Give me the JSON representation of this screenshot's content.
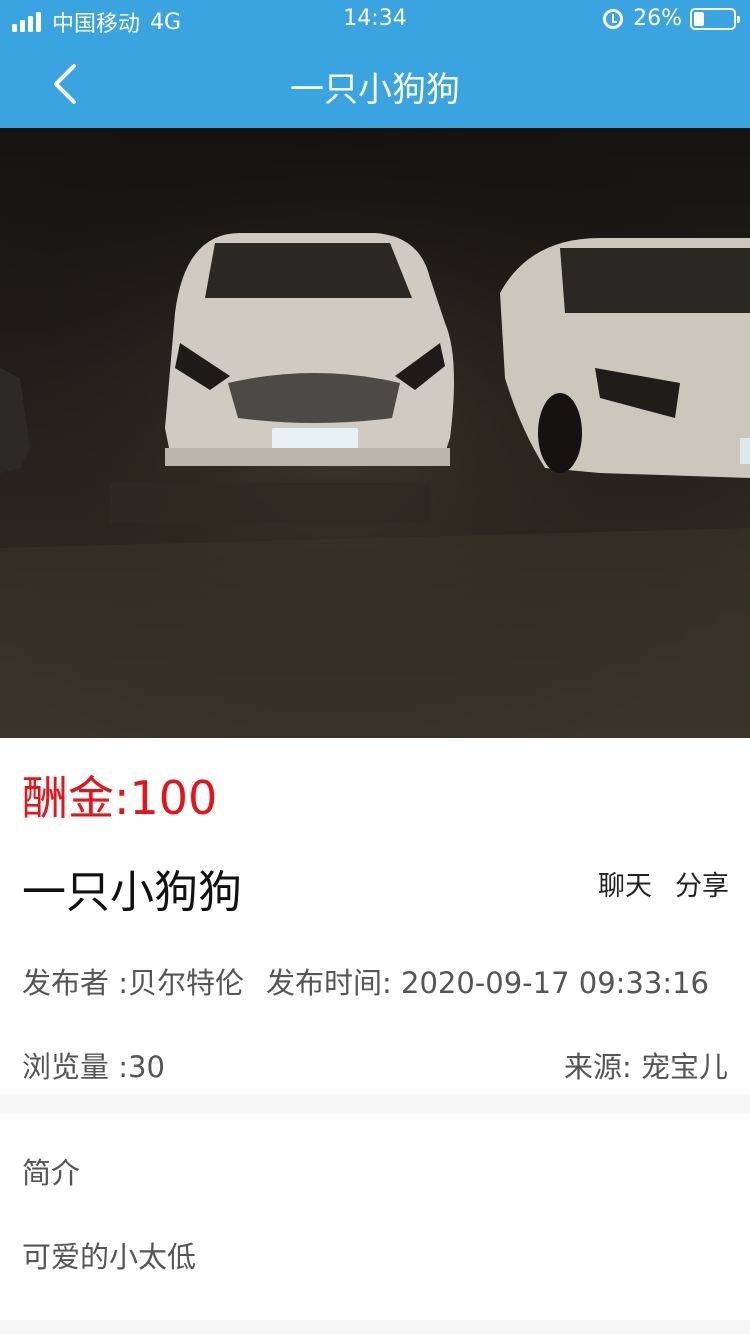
{
  "status_bar": {
    "carrier": "中国移动",
    "network": "4G",
    "time": "14:34",
    "battery_text": "26%",
    "battery_level": 0.26,
    "icons": [
      "signal-icon",
      "alarm-icon",
      "battery-icon"
    ]
  },
  "nav": {
    "back_icon": "chevron-left-icon",
    "title": "一只小狗狗"
  },
  "colors": {
    "nav_bg": "#3aa4e0",
    "reward": "#e5141a",
    "text_primary": "#111111",
    "text_secondary": "#555555",
    "divider": "#f6f6f6"
  },
  "post": {
    "reward": "酬金:100",
    "title": "一只小狗狗",
    "chat_label": "聊天",
    "share_label": "分享",
    "publisher": "发布者 :贝尔特伦",
    "publish_time": "发布时间: 2020-09-17 09:33:16",
    "views": "浏览量 :30",
    "source": "来源: 宠宝儿"
  },
  "intro": {
    "heading": "简介",
    "text": "可爱的小太低"
  }
}
